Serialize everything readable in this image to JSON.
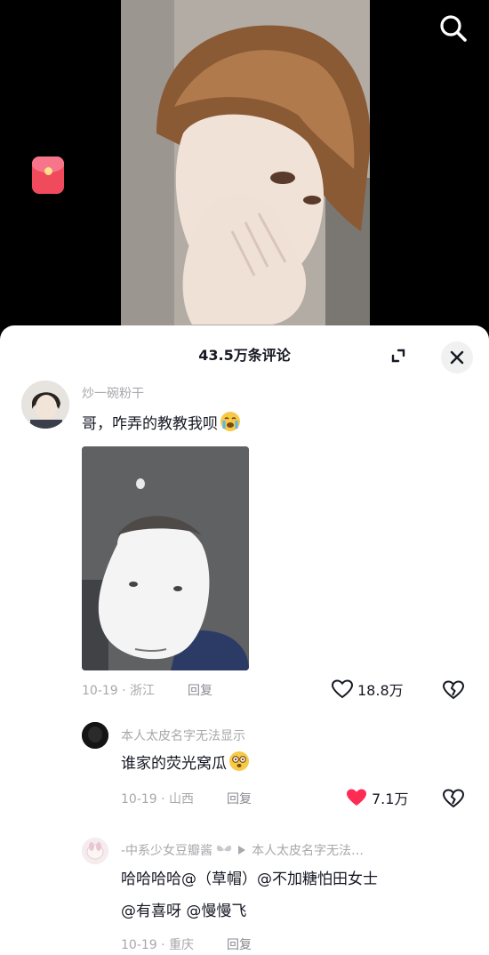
{
  "header": {
    "search_icon": "search-icon"
  },
  "side": {
    "redpacket_icon": "red-envelope-icon",
    "redpacket_color": "#f04a5d"
  },
  "panel": {
    "title": "43.5万条评论"
  },
  "comments": [
    {
      "username": "炒一碗粉干",
      "text": "哥，咋弄的教教我呗",
      "emoji": "crying-emoji",
      "date": "10-19",
      "location": "浙江",
      "reply": "回复",
      "likes": "18.8万",
      "liked": false
    },
    {
      "username": "本人太皮名字无法显示",
      "text": "谁家的荧光窝瓜",
      "emoji": "dizzy-emoji",
      "date": "10-19",
      "location": "山西",
      "reply": "回复",
      "likes": "7.1万",
      "liked": true
    },
    {
      "username": "-中系少女豆瓣酱",
      "reply_to": "本人太皮名字无法…",
      "line1": "哈哈哈哈@（草帽）@不加糖怕田女士",
      "line2": "@有喜呀 @慢慢飞",
      "date": "10-19",
      "location": "重庆",
      "reply": "回复"
    }
  ],
  "colors": {
    "like_red": "#fe2c55",
    "muted": "#a8a8ad",
    "text": "#161823"
  }
}
